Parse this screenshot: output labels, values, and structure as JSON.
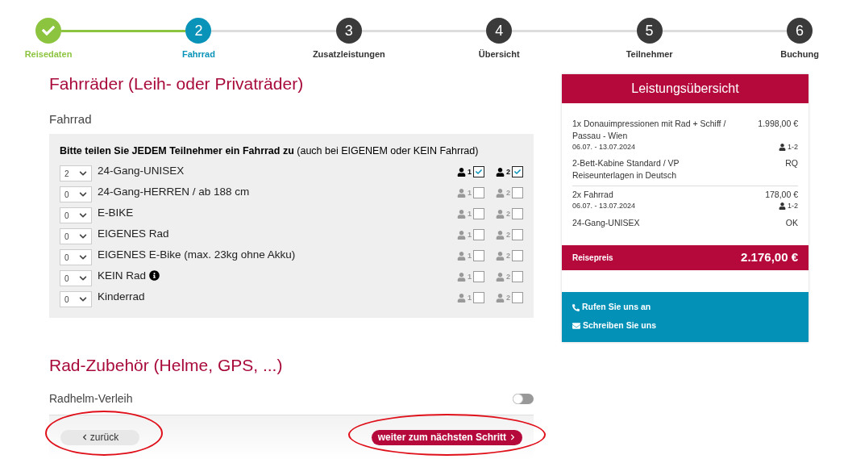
{
  "steps": [
    {
      "label": "Reisedaten",
      "kind": "done"
    },
    {
      "number": "2",
      "label": "Fahrrad",
      "kind": "current"
    },
    {
      "number": "3",
      "label": "Zusatzleistungen",
      "kind": "todo"
    },
    {
      "number": "4",
      "label": "Übersicht",
      "kind": "todo"
    },
    {
      "number": "5",
      "label": "Teilnehmer",
      "kind": "todo"
    },
    {
      "number": "6",
      "label": "Buchung",
      "kind": "todo"
    }
  ],
  "bikes": {
    "title": "Fahrräder (Leih- oder Privaträder)",
    "subtitle": "Fahrrad",
    "instruction": "**Bitte teilen Sie JEDEM Teilnehmer ein Fahrrad zu** (auch bei EIGENEM oder KEIN Fahrrad)",
    "rows": [
      {
        "quantity": "2",
        "name": "24-Gang-UNISEX",
        "info": false,
        "participants": [
          {
            "number": "1",
            "checked": true
          },
          {
            "number": "2",
            "checked": true
          }
        ]
      },
      {
        "quantity": "0",
        "name": "24-Gang-HERREN / ab 188 cm",
        "info": false,
        "participants": [
          {
            "number": "1",
            "checked": false
          },
          {
            "number": "2",
            "checked": false
          }
        ]
      },
      {
        "quantity": "0",
        "name": "E-BIKE",
        "info": false,
        "participants": [
          {
            "number": "1",
            "checked": false
          },
          {
            "number": "2",
            "checked": false
          }
        ]
      },
      {
        "quantity": "0",
        "name": "EIGENES Rad",
        "info": false,
        "participants": [
          {
            "number": "1",
            "checked": false
          },
          {
            "number": "2",
            "checked": false
          }
        ]
      },
      {
        "quantity": "0",
        "name": "EIGENES E-Bike (max. 23kg ohne Akku)",
        "info": false,
        "participants": [
          {
            "number": "1",
            "checked": false
          },
          {
            "number": "2",
            "checked": false
          }
        ]
      },
      {
        "quantity": "0",
        "name": "KEIN Rad",
        "info": true,
        "participants": [
          {
            "number": "1",
            "checked": false
          },
          {
            "number": "2",
            "checked": false
          }
        ]
      },
      {
        "quantity": "0",
        "name": "Kinderrad",
        "info": false,
        "participants": [
          {
            "number": "1",
            "checked": false
          },
          {
            "number": "2",
            "checked": false
          }
        ]
      }
    ]
  },
  "accessories": {
    "title": "Rad-Zubehör (Helme, GPS, ...)",
    "items": [
      {
        "label": "Radhelm-Verleih",
        "on": false
      }
    ]
  },
  "nav": {
    "back": "zurück",
    "next": "weiter zum nächsten Schritt"
  },
  "summary": {
    "title": "Leistungsübersicht",
    "groups": [
      {
        "lines": [
          {
            "left": "1x Donauimpressionen mit Rad + Schiff / Passau - Wien",
            "right": "1.998,00 €"
          },
          {
            "left": "06.07. - 13.07.2024",
            "right": "1-2",
            "kind": "dates"
          },
          {
            "left": "2-Bett-Kabine Standard / VP",
            "right": "RQ"
          },
          {
            "left": "Reiseunterlagen in Deutsch"
          }
        ]
      },
      {
        "lines": [
          {
            "left": "2x Fahrrad",
            "right": "178,00 €"
          },
          {
            "left": "06.07. - 13.07.2024",
            "right": "1-2",
            "kind": "dates"
          },
          {
            "left": "24-Gang-UNISEX",
            "right": "OK"
          }
        ]
      }
    ],
    "total_label": "Reisepreis",
    "total": "2.176,00 €",
    "contacts": [
      {
        "kind": "phone",
        "label": "Rufen Sie uns an"
      },
      {
        "kind": "mail",
        "label": "Schreiben Sie uns"
      }
    ]
  }
}
